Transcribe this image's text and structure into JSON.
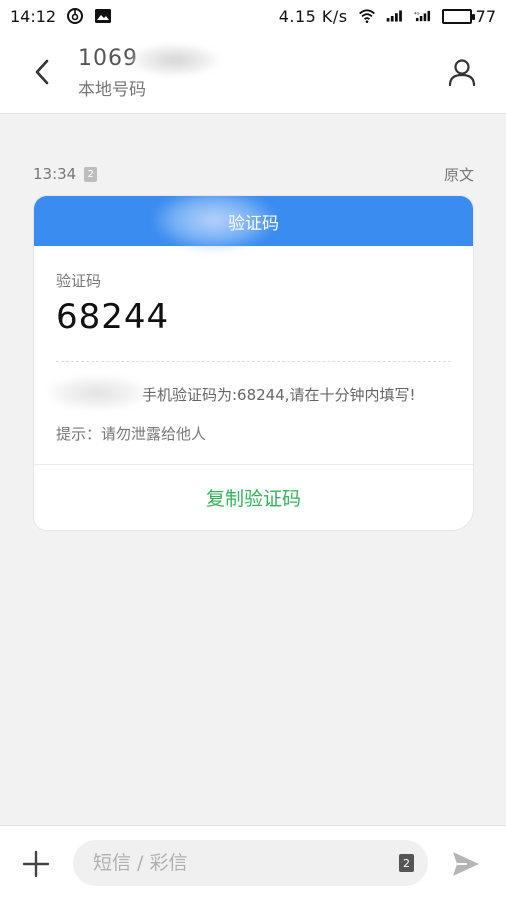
{
  "status_bar": {
    "time": "14:12",
    "net_speed": "4.15 K/s",
    "battery": "77",
    "icons": [
      "netease-music-icon",
      "gallery-notification-icon",
      "wifi-icon",
      "signal-icon",
      "4g-signal-icon",
      "battery-icon"
    ]
  },
  "header": {
    "sender_number": "1069",
    "sender_subtitle": "本地号码",
    "back_icon": "chevron-left-icon",
    "contact_icon": "person-icon"
  },
  "message_meta": {
    "time": "13:34",
    "sim": "2",
    "original_link": "原文"
  },
  "card": {
    "header_title": "验证码",
    "code_label": "验证码",
    "code_value": "68244",
    "message_text": "手机验证码为:68244,请在十分钟内填写!",
    "tip_text": "提示：请勿泄露给他人",
    "copy_button": "复制验证码"
  },
  "input_bar": {
    "placeholder": "短信 / 彩信",
    "sim": "2",
    "add_icon": "plus-icon",
    "send_icon": "send-icon"
  },
  "colors": {
    "accent_blue": "#3b8cf0",
    "action_green": "#35b35a",
    "background": "#f2f2f2"
  }
}
